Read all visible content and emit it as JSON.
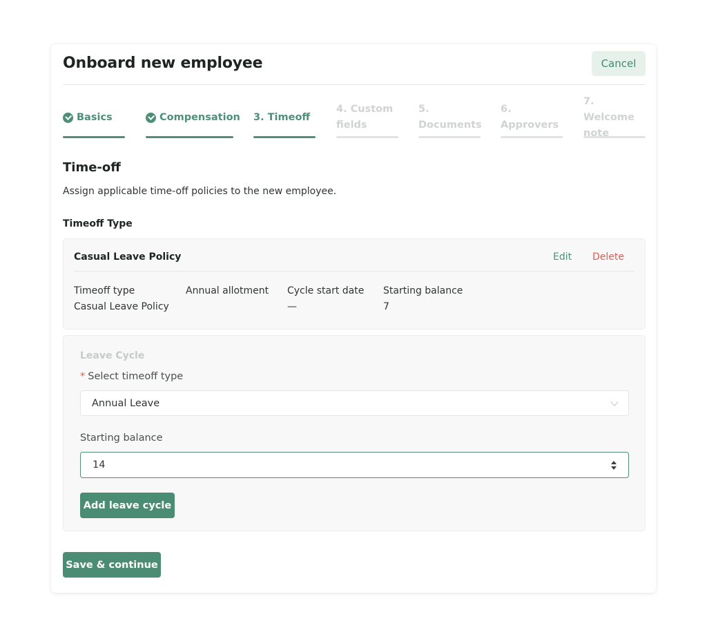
{
  "header": {
    "title": "Onboard new employee",
    "cancel_label": "Cancel"
  },
  "steps": [
    {
      "label": "Basics",
      "state": "done"
    },
    {
      "label": "Compensation",
      "state": "done"
    },
    {
      "label": "3. Timeoff",
      "state": "active"
    },
    {
      "label": "4. Custom fields",
      "state": "todo"
    },
    {
      "label": "5. Documents",
      "state": "todo"
    },
    {
      "label": "6. Approvers",
      "state": "todo"
    },
    {
      "label": "7. Welcome note",
      "state": "todo"
    }
  ],
  "section": {
    "title": "Time-off",
    "description": "Assign applicable time-off policies to the new employee.",
    "type_label": "Timeoff Type"
  },
  "policy": {
    "name": "Casual Leave Policy",
    "edit_label": "Edit",
    "delete_label": "Delete",
    "columns": [
      {
        "header": "Timeoff type",
        "value": "Casual Leave Policy"
      },
      {
        "header": "Annual allotment",
        "value": ""
      },
      {
        "header": "Cycle start date",
        "value": "—"
      },
      {
        "header": "Starting balance",
        "value": "7"
      }
    ]
  },
  "leave_cycle": {
    "title": "Leave Cycle",
    "select_label": "Select timeoff type",
    "select_value": "Annual Leave",
    "balance_label": "Starting balance",
    "balance_value": "14",
    "add_label": "Add leave cycle"
  },
  "footer": {
    "save_label": "Save & continue"
  },
  "colors": {
    "accent": "#4f8f78",
    "danger": "#e45a50",
    "inactive": "#cfd3d1"
  }
}
